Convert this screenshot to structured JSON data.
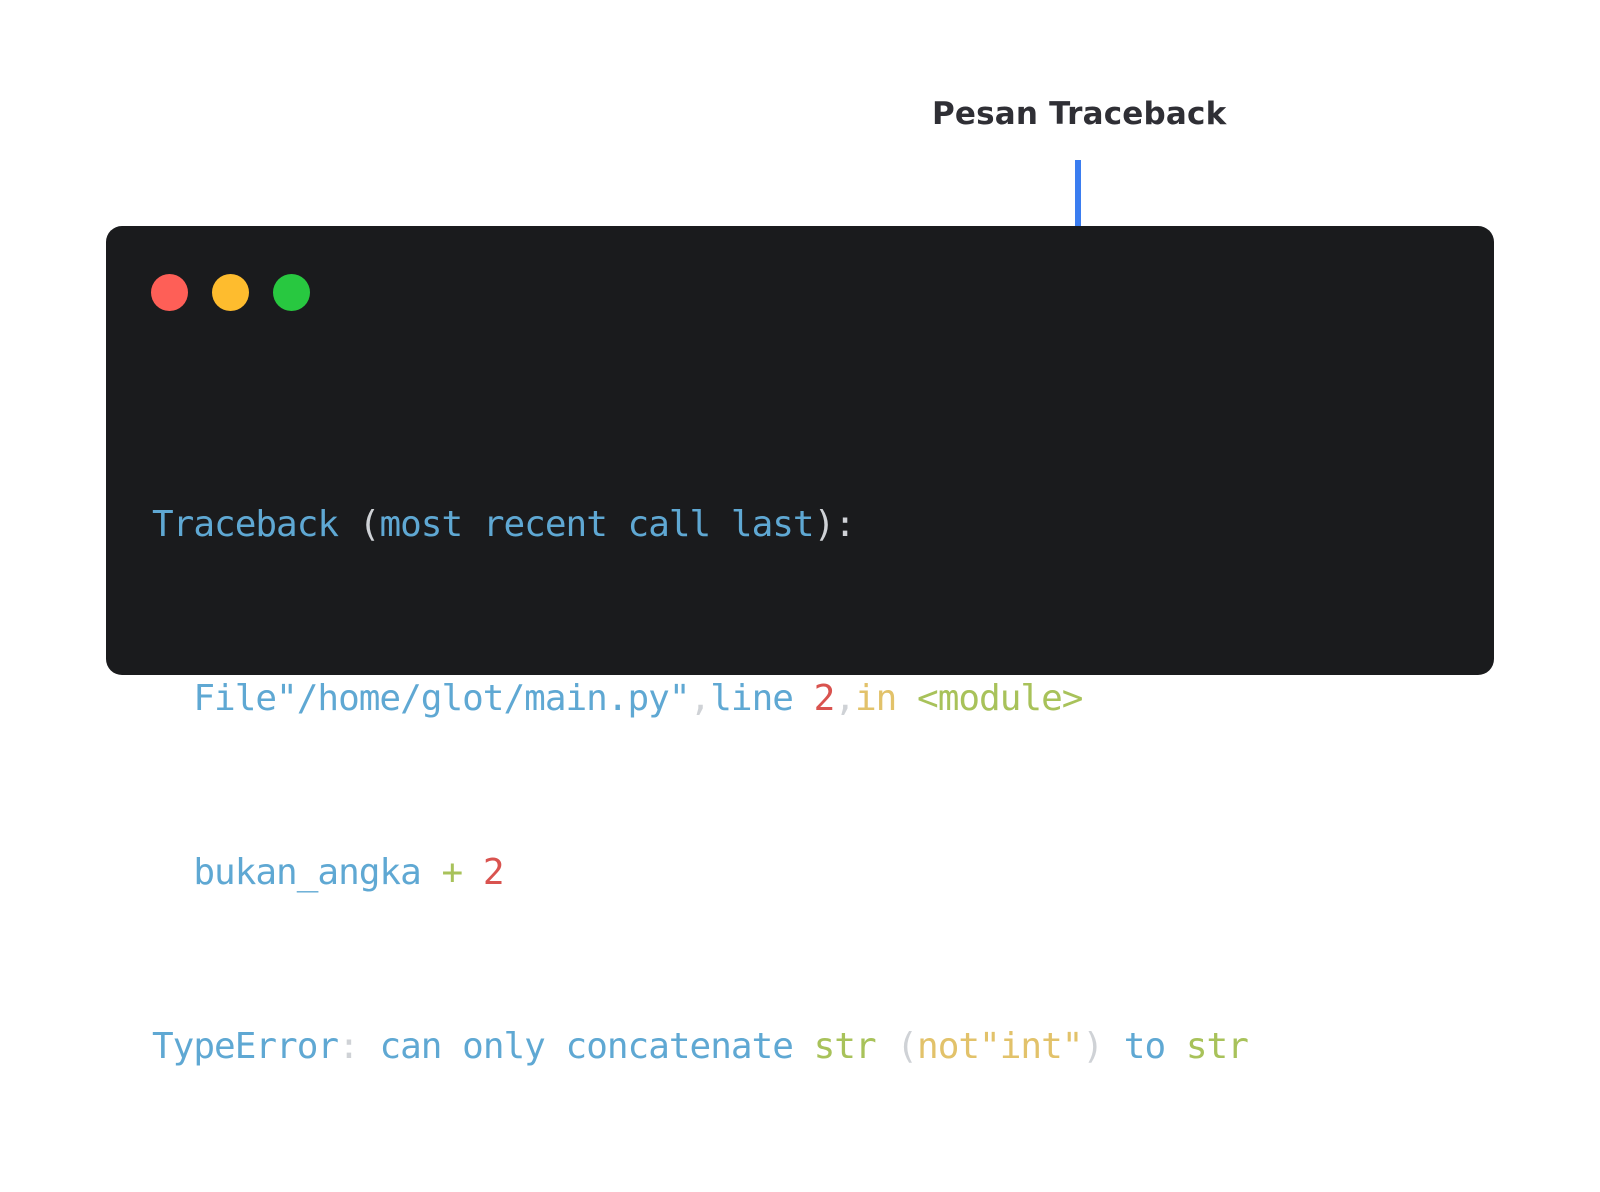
{
  "annotation": {
    "label": "Pesan Traceback",
    "arrow_color": "#3b7df0"
  },
  "window": {
    "background": "#1a1b1d",
    "controls": [
      "close-dot",
      "minimize-dot",
      "maximize-dot"
    ],
    "control_colors": [
      "#fe5f57",
      "#febc2e",
      "#28c840"
    ]
  },
  "code": {
    "line1": {
      "kw": "Traceback",
      "paren_open": "(",
      "text": "most recent call last",
      "paren_close": ")",
      "colon": ":"
    },
    "line2": {
      "file": "File\"/home/glot/main.py\"",
      "comma1": ",",
      "line_kw": "line",
      "line_num": "2",
      "comma2": ",",
      "in_kw": "in",
      "module": "<module>"
    },
    "line3": {
      "var": "bukan_angka",
      "op": "+",
      "num": "2"
    },
    "line4": {
      "err": "TypeError",
      "colon": ":",
      "msg": "can only concatenate",
      "str1": "str",
      "paren_open": "(",
      "not_int": "not\"int\"",
      "paren_close": ")",
      "to": "to",
      "str2": "str"
    }
  },
  "colors": {
    "blue": "#5fa8d3",
    "plain": "#cfd2d6",
    "red": "#d9534f",
    "gold": "#e2c26a",
    "green": "#a8c25a"
  }
}
